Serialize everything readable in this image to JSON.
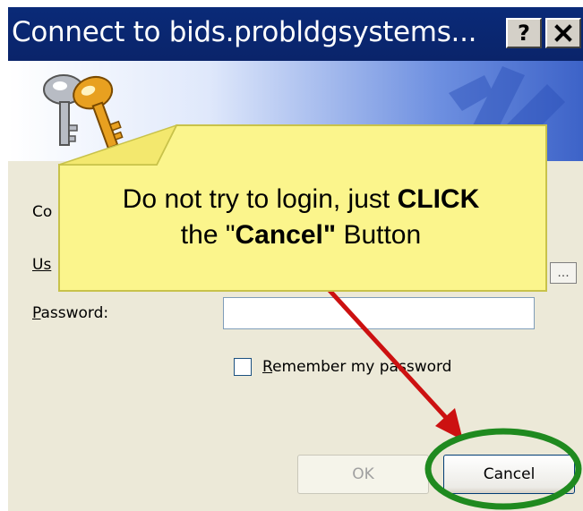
{
  "window": {
    "title": "Connect to bids.probldgsystems...",
    "help_label": "?",
    "close_label": "✕"
  },
  "form": {
    "connect_label_partial": "Co",
    "username_label_partial": "Us",
    "password_label": "Password:",
    "password_value": "",
    "browse_label": "...",
    "remember_label": "Remember my password",
    "remember_checked": false
  },
  "buttons": {
    "ok_label": "OK",
    "cancel_label": "Cancel"
  },
  "callout": {
    "line1_normal": "Do not try to login, just ",
    "line1_bold": "CLICK",
    "line2_pre": "the \"",
    "line2_bold": "Cancel\"",
    "line2_post": " Button",
    "background_color": "#fbf58c",
    "border_color": "#c8c24a"
  },
  "annotation": {
    "arrow_color": "#cc1111",
    "ellipse_color": "#1f8a1f"
  },
  "colors": {
    "titlebar": "#0a246a",
    "dialog_background": "#ece9d8"
  }
}
